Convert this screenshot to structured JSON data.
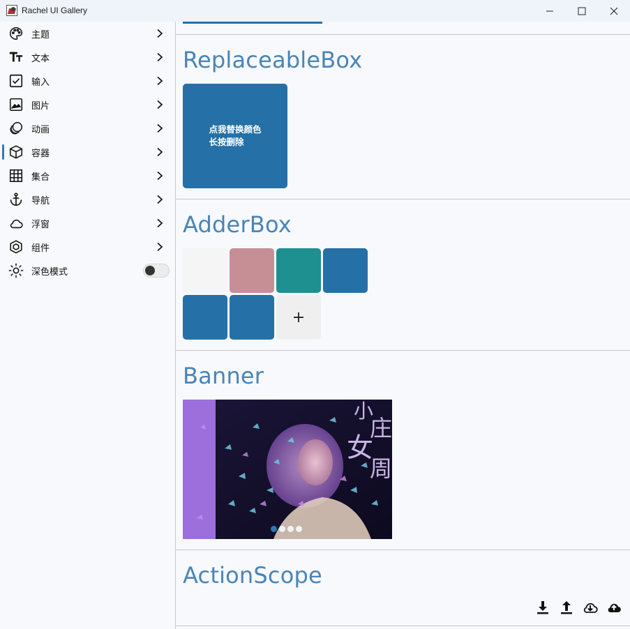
{
  "window": {
    "title": "Rachel UI Gallery"
  },
  "sidebar": {
    "items": [
      {
        "label": "主题",
        "icon": "palette-icon"
      },
      {
        "label": "文本",
        "icon": "text-icon"
      },
      {
        "label": "输入",
        "icon": "checkbox-icon"
      },
      {
        "label": "图片",
        "icon": "image-icon"
      },
      {
        "label": "动画",
        "icon": "animation-icon"
      },
      {
        "label": "容器",
        "icon": "box-icon",
        "active": true
      },
      {
        "label": "集合",
        "icon": "grid-icon"
      },
      {
        "label": "导航",
        "icon": "anchor-icon"
      },
      {
        "label": "浮窗",
        "icon": "cloud-icon"
      },
      {
        "label": "组件",
        "icon": "component-icon"
      }
    ],
    "dark_mode": {
      "label": "深色模式",
      "icon": "sun-icon",
      "enabled": false
    }
  },
  "main": {
    "replaceable": {
      "title": "ReplaceableBox",
      "line1": "点我替换颜色",
      "line2": "长按删除",
      "color": "#2570a6"
    },
    "adder": {
      "title": "AdderBox",
      "colors": [
        "#f5f5f5",
        "#c68f96",
        "#1e9090",
        "#2570a6",
        "#2570a6",
        "#2570a6"
      ],
      "add_label": "+"
    },
    "banner": {
      "title": "Banner",
      "pages": 4,
      "active_page": 0,
      "overlay_chars": [
        "小",
        "女",
        "庄",
        "周"
      ]
    },
    "action": {
      "title": "ActionScope",
      "icons": [
        "download-icon",
        "upload-icon",
        "cloud-download-icon",
        "cloud-upload-icon"
      ]
    }
  },
  "colors": {
    "accent": "#2570a6",
    "title_blue": "#4a84b6"
  }
}
